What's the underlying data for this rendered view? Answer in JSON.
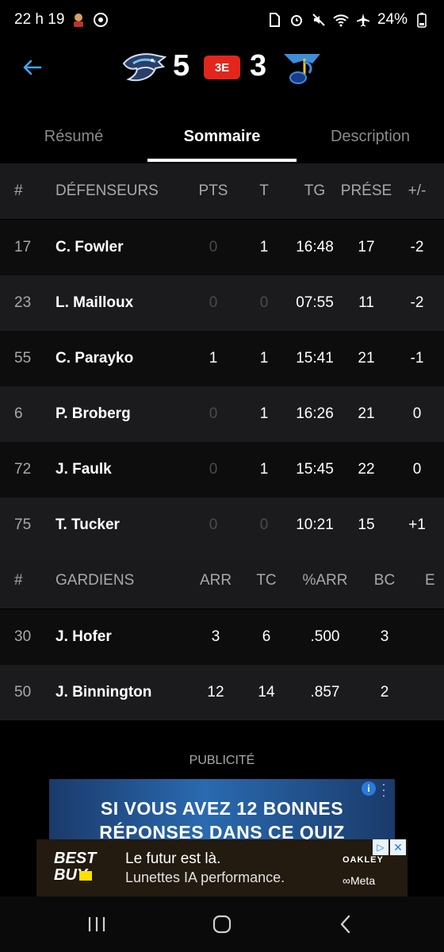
{
  "status_bar": {
    "time": "22 h 19",
    "battery": "24%"
  },
  "header": {
    "home_score": "5",
    "period": "3E",
    "away_score": "3"
  },
  "tabs": [
    {
      "label": "Résumé",
      "active": false
    },
    {
      "label": "Sommaire",
      "active": true
    },
    {
      "label": "Description",
      "active": false
    }
  ],
  "defense": {
    "headers": [
      "#",
      "DÉFENSEURS",
      "PTS",
      "T",
      "TG",
      "PRÉSE",
      "+/-"
    ],
    "rows": [
      {
        "num": "17",
        "name": "C. Fowler",
        "pts": "0",
        "t": "1",
        "tg": "16:48",
        "prese": "17",
        "pm": "-2"
      },
      {
        "num": "23",
        "name": "L. Mailloux",
        "pts": "0",
        "t": "0",
        "tg": "07:55",
        "prese": "11",
        "pm": "-2"
      },
      {
        "num": "55",
        "name": "C. Parayko",
        "pts": "1",
        "t": "1",
        "tg": "15:41",
        "prese": "21",
        "pm": "-1"
      },
      {
        "num": "6",
        "name": "P. Broberg",
        "pts": "0",
        "t": "1",
        "tg": "16:26",
        "prese": "21",
        "pm": "0"
      },
      {
        "num": "72",
        "name": "J. Faulk",
        "pts": "0",
        "t": "1",
        "tg": "15:45",
        "prese": "22",
        "pm": "0"
      },
      {
        "num": "75",
        "name": "T. Tucker",
        "pts": "0",
        "t": "0",
        "tg": "10:21",
        "prese": "15",
        "pm": "+1"
      }
    ]
  },
  "goalies": {
    "headers": [
      "#",
      "GARDIENS",
      "ARR",
      "TC",
      "%ARR",
      "BC",
      "E"
    ],
    "rows": [
      {
        "num": "30",
        "name": "J. Hofer",
        "arr": "3",
        "tc": "6",
        "pct": ".500",
        "bc": "3"
      },
      {
        "num": "50",
        "name": "J. Binnington",
        "arr": "12",
        "tc": "14",
        "pct": ".857",
        "bc": "2"
      }
    ]
  },
  "ad": {
    "label": "PUBLICITÉ",
    "banner_line1": "SI VOUS AVEZ 12 BONNES",
    "banner_line2": "RÉPONSES DANS CE QUIZ",
    "brand_line1": "BEST",
    "brand_line2": "BUY",
    "title": "Le futur est là.",
    "subtitle": "Lunettes IA performance.",
    "partner1": "OAKLEY",
    "partner2": "∞Meta"
  }
}
